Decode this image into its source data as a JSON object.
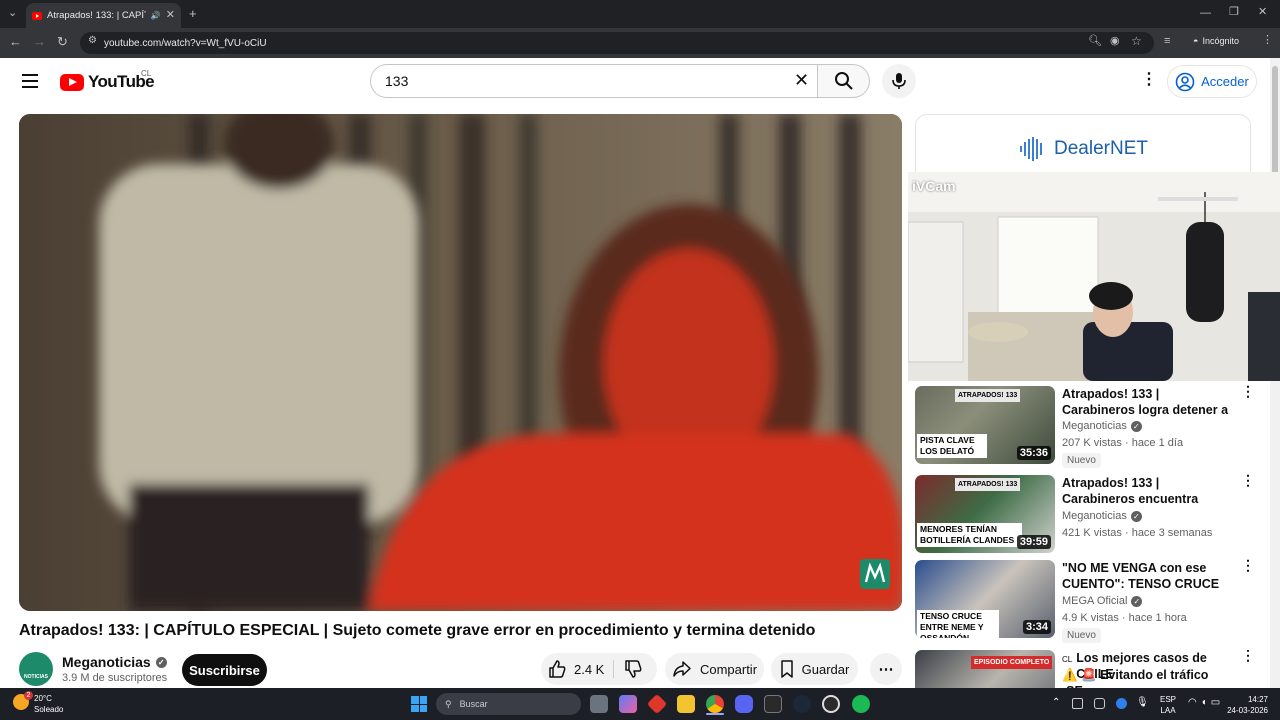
{
  "browser": {
    "tab_title": "Atrapados! 133: | CAPÍTULO",
    "url": "youtube.com/watch?v=Wt_fVU-oCiU",
    "incognito_label": "Incógnito"
  },
  "header": {
    "logo_text": "YouTube",
    "country_code": "CL",
    "search_value": "133",
    "signin_label": "Acceder"
  },
  "video": {
    "title": "Atrapados! 133: | CAPÍTULO ESPECIAL | Sujeto comete grave error en procedimiento y termina detenido",
    "channel": "Meganoticias",
    "subscribers": "3.9 M de suscriptores",
    "subscribe_label": "Suscribirse",
    "likes": "2.4 K",
    "share_label": "Compartir",
    "save_label": "Guardar",
    "avatar_text": "NOTICIAS"
  },
  "ad": {
    "brand": "DealerNET"
  },
  "overlay": {
    "label": "iVCam"
  },
  "recommendations": [
    {
      "title": "Atrapados! 133 | Carabineros logra detener a peligrosos ...",
      "channel": "Meganoticias",
      "meta": "207 K vistas · hace 1 día",
      "badge": "Nuevo",
      "duration": "35:36",
      "caption_top": "ATRAPADOS! 133",
      "caption_bottom": "PISTA CLAVE LOS DELATÓ"
    },
    {
      "title": "Atrapados! 133 | Carabineros encuentra botillería clandestin...",
      "channel": "Meganoticias",
      "meta": "421 K vistas · hace 3 semanas",
      "badge": "",
      "duration": "39:59",
      "caption_top": "ATRAPADOS! 133",
      "caption_bottom": "MENORES TENÍAN BOTILLERÍA CLANDES"
    },
    {
      "title": "\"NO ME VENGA con ese CUENTO\": TENSO CRUCE entr...",
      "channel": "MEGA Oficial",
      "meta": "4.9 K vistas · hace 1 hora",
      "badge": "Nuevo",
      "duration": "3:34",
      "caption_top": "",
      "caption_bottom": "TENSO CRUCE ENTRE NEME Y OSSANDÓN"
    },
    {
      "title": "Los mejores casos de CHILE",
      "title_prefix": "CL",
      "subtitle": "⚠️ 🚨 Evitando el tráfico ¡SE ...",
      "caption_top": "EPISODIO COMPLETO"
    }
  ],
  "taskbar": {
    "temperature": "20°C",
    "weather": "Soleado",
    "search_placeholder": "Buscar",
    "lang_top": "ESP",
    "lang_bottom": "LAA",
    "time": "14:27",
    "date": "24-03-2026",
    "weather_badge": "2"
  },
  "colors": {
    "youtube_red": "#ff0000",
    "link_blue": "#065fd4",
    "chrome_dark": "#202124",
    "chrome_toolbar": "#35363a",
    "taskbar": "#1c1f26"
  }
}
